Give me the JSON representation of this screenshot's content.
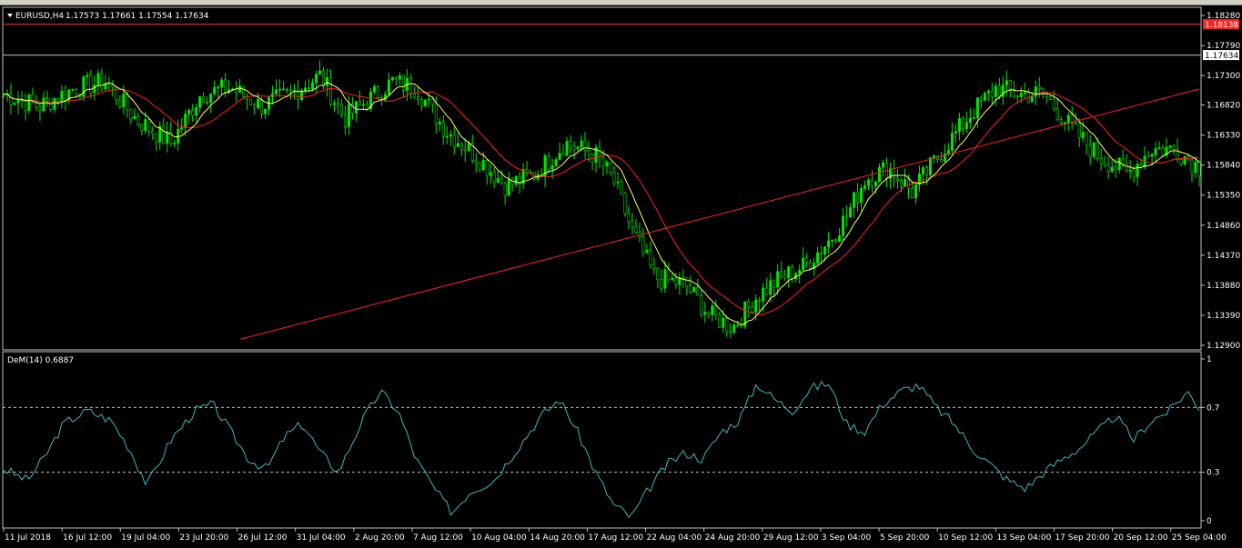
{
  "window": {
    "symbol_title": "EURUSD,H4",
    "ohlc": "1.17573 1.17661 1.17554 1.17634"
  },
  "chart_data": [
    {
      "type": "candlestick",
      "name": "EURUSD,H4",
      "ylim": [
        1.129,
        1.1828
      ],
      "y_ticks": [
        "1.18280",
        "1.17790",
        "1.17300",
        "1.16820",
        "1.16330",
        "1.15840",
        "1.15350",
        "1.14860",
        "1.14370",
        "1.13880",
        "1.13390",
        "1.12900"
      ],
      "x_ticks": [
        "11 Jul 2018",
        "16 Jul 12:00",
        "19 Jul 04:00",
        "23 Jul 20:00",
        "26 Jul 12:00",
        "31 Jul 04:00",
        "2 Aug 20:00",
        "7 Aug 12:00",
        "10 Aug 04:00",
        "14 Aug 20:00",
        "17 Aug 12:00",
        "22 Aug 04:00",
        "24 Aug 20:00",
        "29 Aug 12:00",
        "3 Sep 04:00",
        "5 Sep 20:00",
        "10 Sep 12:00",
        "13 Sep 04:00",
        "17 Sep 20:00",
        "20 Sep 12:00",
        "25 Sep 04:00"
      ],
      "price_labels": {
        "resistance": "1.18138",
        "current": "1.17634"
      },
      "resistance_level": 1.18138,
      "current_price": 1.17634,
      "trendline": [
        [
          0.198,
          1.13
        ],
        [
          1.0,
          1.1708
        ]
      ],
      "close_path": [
        [
          0.0,
          1.17
        ],
        [
          0.03,
          1.168
        ],
        [
          0.06,
          1.171
        ],
        [
          0.085,
          1.172
        ],
        [
          0.11,
          1.166
        ],
        [
          0.14,
          1.162
        ],
        [
          0.165,
          1.17
        ],
        [
          0.19,
          1.171
        ],
        [
          0.215,
          1.168
        ],
        [
          0.24,
          1.17
        ],
        [
          0.265,
          1.173
        ],
        [
          0.285,
          1.166
        ],
        [
          0.305,
          1.169
        ],
        [
          0.325,
          1.172
        ],
        [
          0.345,
          1.171
        ],
        [
          0.37,
          1.164
        ],
        [
          0.395,
          1.16
        ],
        [
          0.42,
          1.155
        ],
        [
          0.445,
          1.157
        ],
        [
          0.47,
          1.162
        ],
        [
          0.495,
          1.16
        ],
        [
          0.51,
          1.156
        ],
        [
          0.525,
          1.148
        ],
        [
          0.545,
          1.14
        ],
        [
          0.57,
          1.139
        ],
        [
          0.59,
          1.134
        ],
        [
          0.61,
          1.132
        ],
        [
          0.63,
          1.137
        ],
        [
          0.65,
          1.14
        ],
        [
          0.67,
          1.142
        ],
        [
          0.69,
          1.146
        ],
        [
          0.705,
          1.15
        ],
        [
          0.72,
          1.156
        ],
        [
          0.74,
          1.158
        ],
        [
          0.76,
          1.154
        ],
        [
          0.775,
          1.158
        ],
        [
          0.79,
          1.162
        ],
        [
          0.81,
          1.167
        ],
        [
          0.83,
          1.171
        ],
        [
          0.85,
          1.17
        ],
        [
          0.87,
          1.17
        ],
        [
          0.895,
          1.164
        ],
        [
          0.915,
          1.16
        ],
        [
          0.94,
          1.157
        ],
        [
          0.96,
          1.161
        ],
        [
          0.98,
          1.161
        ],
        [
          1.0,
          1.158
        ]
      ],
      "indicators": [
        {
          "kind": "moving-average-fast",
          "color": "#ffff66"
        },
        {
          "kind": "moving-average-slow",
          "color": "#ff2020"
        }
      ],
      "colors": {
        "bull": "#00e600",
        "bear": "#00e600",
        "background": "#000000",
        "grid_line": "#c0c0c0"
      }
    },
    {
      "type": "line",
      "name": "DeM(14)",
      "title": "DeM(14) 0.6887",
      "current_value": 0.6887,
      "ylim": [
        0,
        1
      ],
      "y_ticks": [
        "1",
        "0.7",
        "0.3",
        "0"
      ],
      "levels": [
        0.7,
        0.3
      ],
      "color": "#3fb7c0",
      "path": [
        [
          0.0,
          0.32
        ],
        [
          0.02,
          0.25
        ],
        [
          0.035,
          0.4
        ],
        [
          0.05,
          0.6
        ],
        [
          0.07,
          0.68
        ],
        [
          0.09,
          0.62
        ],
        [
          0.105,
          0.45
        ],
        [
          0.12,
          0.22
        ],
        [
          0.14,
          0.5
        ],
        [
          0.16,
          0.68
        ],
        [
          0.175,
          0.72
        ],
        [
          0.19,
          0.55
        ],
        [
          0.205,
          0.38
        ],
        [
          0.22,
          0.32
        ],
        [
          0.235,
          0.52
        ],
        [
          0.25,
          0.6
        ],
        [
          0.265,
          0.42
        ],
        [
          0.28,
          0.3
        ],
        [
          0.3,
          0.62
        ],
        [
          0.315,
          0.8
        ],
        [
          0.33,
          0.68
        ],
        [
          0.345,
          0.38
        ],
        [
          0.36,
          0.2
        ],
        [
          0.375,
          0.05
        ],
        [
          0.39,
          0.18
        ],
        [
          0.41,
          0.25
        ],
        [
          0.43,
          0.45
        ],
        [
          0.45,
          0.65
        ],
        [
          0.465,
          0.75
        ],
        [
          0.48,
          0.55
        ],
        [
          0.495,
          0.3
        ],
        [
          0.51,
          0.1
        ],
        [
          0.525,
          0.02
        ],
        [
          0.54,
          0.2
        ],
        [
          0.555,
          0.35
        ],
        [
          0.57,
          0.42
        ],
        [
          0.585,
          0.38
        ],
        [
          0.6,
          0.55
        ],
        [
          0.615,
          0.62
        ],
        [
          0.63,
          0.85
        ],
        [
          0.645,
          0.75
        ],
        [
          0.66,
          0.68
        ],
        [
          0.675,
          0.82
        ],
        [
          0.69,
          0.85
        ],
        [
          0.705,
          0.6
        ],
        [
          0.72,
          0.55
        ],
        [
          0.735,
          0.72
        ],
        [
          0.75,
          0.8
        ],
        [
          0.765,
          0.84
        ],
        [
          0.78,
          0.7
        ],
        [
          0.795,
          0.6
        ],
        [
          0.81,
          0.45
        ],
        [
          0.825,
          0.35
        ],
        [
          0.84,
          0.25
        ],
        [
          0.855,
          0.2
        ],
        [
          0.87,
          0.3
        ],
        [
          0.885,
          0.38
        ],
        [
          0.9,
          0.45
        ],
        [
          0.915,
          0.55
        ],
        [
          0.93,
          0.65
        ],
        [
          0.945,
          0.5
        ],
        [
          0.96,
          0.62
        ],
        [
          0.975,
          0.68
        ],
        [
          0.99,
          0.8
        ],
        [
          1.0,
          0.7
        ]
      ]
    }
  ]
}
